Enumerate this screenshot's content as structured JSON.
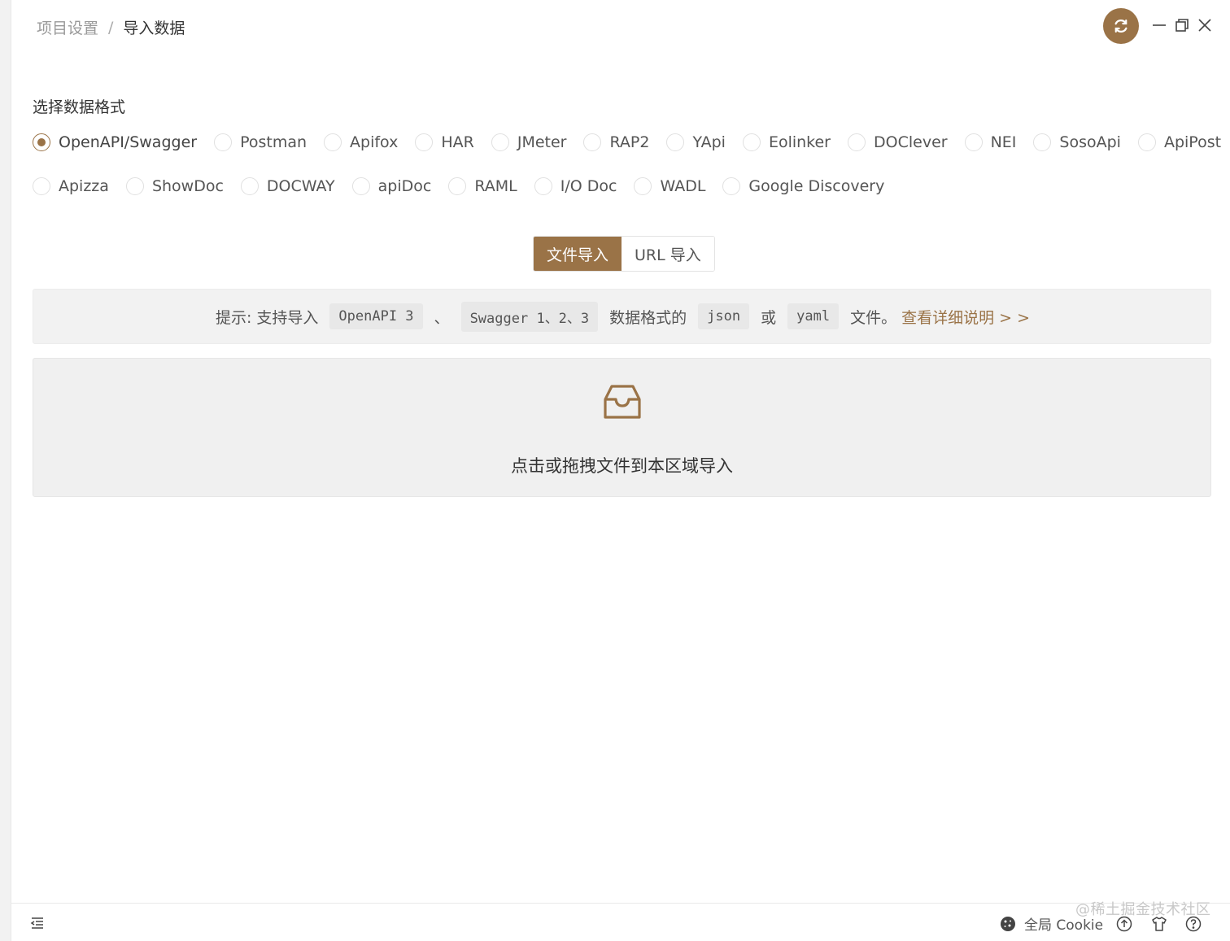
{
  "breadcrumb": {
    "parent": "项目设置",
    "separator": "/",
    "current": "导入数据"
  },
  "window_controls": {
    "sync": "sync-icon",
    "minimize": "minimize-icon",
    "maximize": "restore-icon",
    "close": "close-icon"
  },
  "section_title": "选择数据格式",
  "formats_row1": [
    {
      "label": "OpenAPI/Swagger",
      "selected": true
    },
    {
      "label": "Postman"
    },
    {
      "label": "Apifox"
    },
    {
      "label": "HAR"
    },
    {
      "label": "JMeter"
    },
    {
      "label": "RAP2"
    },
    {
      "label": "YApi"
    },
    {
      "label": "Eolinker"
    },
    {
      "label": "DOClever"
    },
    {
      "label": "NEI"
    },
    {
      "label": "SosoApi"
    },
    {
      "label": "ApiPost"
    }
  ],
  "formats_row2": [
    {
      "label": "Apizza"
    },
    {
      "label": "ShowDoc"
    },
    {
      "label": "DOCWAY"
    },
    {
      "label": "apiDoc"
    },
    {
      "label": "RAML"
    },
    {
      "label": "I/O Doc"
    },
    {
      "label": "WADL"
    },
    {
      "label": "Google Discovery"
    }
  ],
  "import_tabs": {
    "file": "文件导入",
    "url": "URL 导入",
    "active": "file"
  },
  "hint": {
    "prefix": "提示: 支持导入",
    "code1": "OpenAPI 3",
    "sep1": "、",
    "code2": "Swagger 1、2、3",
    "mid": "数据格式的",
    "code3": "json",
    "or": "或",
    "code4": "yaml",
    "suffix": "文件。",
    "link": "查看详细说明 > >"
  },
  "dropzone": {
    "icon": "inbox-icon",
    "text": "点击或拖拽文件到本区域导入"
  },
  "footer": {
    "cookie_label": "全局 Cookie",
    "watermark": "@稀土掘金技术社区"
  },
  "colors": {
    "accent": "#9a7347",
    "hint_bg": "#f2f2f2",
    "dropzone_bg": "#f0f0f0"
  }
}
